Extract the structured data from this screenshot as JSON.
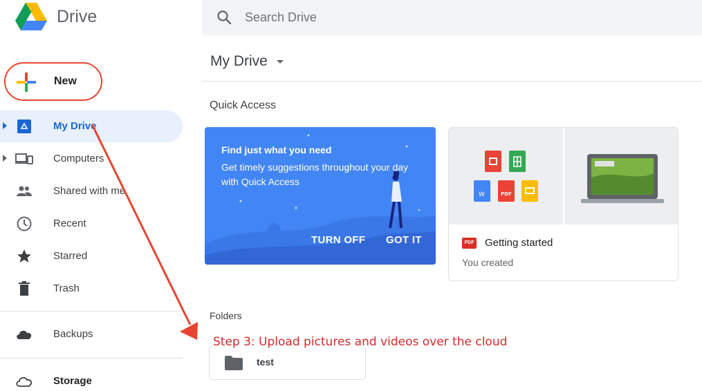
{
  "header": {
    "brand": "Drive"
  },
  "search": {
    "placeholder": "Search Drive"
  },
  "sidebar": {
    "new_label": "New",
    "items": [
      {
        "label": "My Drive",
        "icon": "my-drive-icon"
      },
      {
        "label": "Computers",
        "icon": "computers-icon"
      },
      {
        "label": "Shared with me",
        "icon": "shared-icon"
      },
      {
        "label": "Recent",
        "icon": "clock-icon"
      },
      {
        "label": "Starred",
        "icon": "star-icon"
      },
      {
        "label": "Trash",
        "icon": "trash-icon"
      },
      {
        "label": "Backups",
        "icon": "cloud-icon"
      },
      {
        "label": "Storage",
        "icon": "cloud-outline-icon"
      }
    ]
  },
  "main": {
    "title": "My Drive",
    "quick_access_label": "Quick Access",
    "promo": {
      "title": "Find just what you need",
      "text": "Get timely suggestions throughout your day with Quick Access",
      "turn_off_label": "TURN OFF",
      "got_it_label": "GOT IT"
    },
    "file": {
      "name": "Getting started",
      "meta": "You created",
      "badge": "PDF"
    },
    "folders_label": "Folders",
    "folders": [
      {
        "name": "test"
      }
    ]
  },
  "annotation": {
    "text": "Step 3: Upload pictures and videos over the cloud"
  },
  "colors": {
    "accent": "#1967d2",
    "promo": "#4285f4",
    "annotation": "#d42a2a",
    "active_nav": "#e8f0fe"
  }
}
